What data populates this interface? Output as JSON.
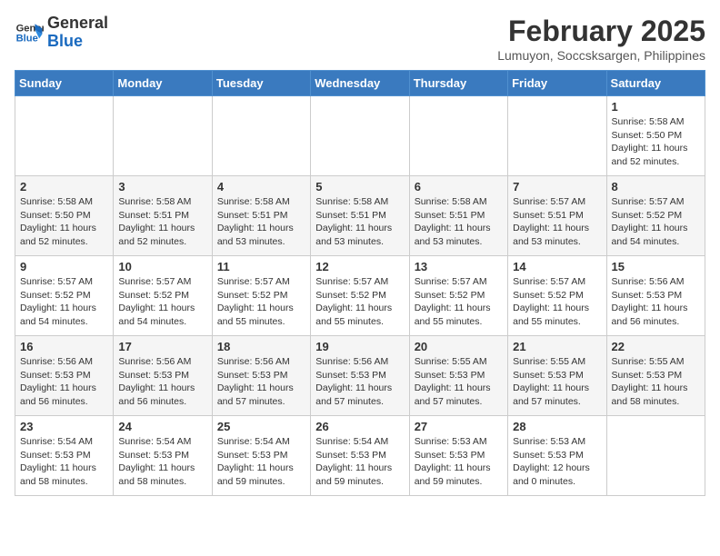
{
  "header": {
    "logo_line1": "General",
    "logo_line2": "Blue",
    "month_title": "February 2025",
    "subtitle": "Lumuyon, Soccsksargen, Philippines"
  },
  "weekdays": [
    "Sunday",
    "Monday",
    "Tuesday",
    "Wednesday",
    "Thursday",
    "Friday",
    "Saturday"
  ],
  "weeks": [
    [
      {
        "day": "",
        "info": ""
      },
      {
        "day": "",
        "info": ""
      },
      {
        "day": "",
        "info": ""
      },
      {
        "day": "",
        "info": ""
      },
      {
        "day": "",
        "info": ""
      },
      {
        "day": "",
        "info": ""
      },
      {
        "day": "1",
        "info": "Sunrise: 5:58 AM\nSunset: 5:50 PM\nDaylight: 11 hours\nand 52 minutes."
      }
    ],
    [
      {
        "day": "2",
        "info": "Sunrise: 5:58 AM\nSunset: 5:50 PM\nDaylight: 11 hours\nand 52 minutes."
      },
      {
        "day": "3",
        "info": "Sunrise: 5:58 AM\nSunset: 5:51 PM\nDaylight: 11 hours\nand 52 minutes."
      },
      {
        "day": "4",
        "info": "Sunrise: 5:58 AM\nSunset: 5:51 PM\nDaylight: 11 hours\nand 53 minutes."
      },
      {
        "day": "5",
        "info": "Sunrise: 5:58 AM\nSunset: 5:51 PM\nDaylight: 11 hours\nand 53 minutes."
      },
      {
        "day": "6",
        "info": "Sunrise: 5:58 AM\nSunset: 5:51 PM\nDaylight: 11 hours\nand 53 minutes."
      },
      {
        "day": "7",
        "info": "Sunrise: 5:57 AM\nSunset: 5:51 PM\nDaylight: 11 hours\nand 53 minutes."
      },
      {
        "day": "8",
        "info": "Sunrise: 5:57 AM\nSunset: 5:52 PM\nDaylight: 11 hours\nand 54 minutes."
      }
    ],
    [
      {
        "day": "9",
        "info": "Sunrise: 5:57 AM\nSunset: 5:52 PM\nDaylight: 11 hours\nand 54 minutes."
      },
      {
        "day": "10",
        "info": "Sunrise: 5:57 AM\nSunset: 5:52 PM\nDaylight: 11 hours\nand 54 minutes."
      },
      {
        "day": "11",
        "info": "Sunrise: 5:57 AM\nSunset: 5:52 PM\nDaylight: 11 hours\nand 55 minutes."
      },
      {
        "day": "12",
        "info": "Sunrise: 5:57 AM\nSunset: 5:52 PM\nDaylight: 11 hours\nand 55 minutes."
      },
      {
        "day": "13",
        "info": "Sunrise: 5:57 AM\nSunset: 5:52 PM\nDaylight: 11 hours\nand 55 minutes."
      },
      {
        "day": "14",
        "info": "Sunrise: 5:57 AM\nSunset: 5:52 PM\nDaylight: 11 hours\nand 55 minutes."
      },
      {
        "day": "15",
        "info": "Sunrise: 5:56 AM\nSunset: 5:53 PM\nDaylight: 11 hours\nand 56 minutes."
      }
    ],
    [
      {
        "day": "16",
        "info": "Sunrise: 5:56 AM\nSunset: 5:53 PM\nDaylight: 11 hours\nand 56 minutes."
      },
      {
        "day": "17",
        "info": "Sunrise: 5:56 AM\nSunset: 5:53 PM\nDaylight: 11 hours\nand 56 minutes."
      },
      {
        "day": "18",
        "info": "Sunrise: 5:56 AM\nSunset: 5:53 PM\nDaylight: 11 hours\nand 57 minutes."
      },
      {
        "day": "19",
        "info": "Sunrise: 5:56 AM\nSunset: 5:53 PM\nDaylight: 11 hours\nand 57 minutes."
      },
      {
        "day": "20",
        "info": "Sunrise: 5:55 AM\nSunset: 5:53 PM\nDaylight: 11 hours\nand 57 minutes."
      },
      {
        "day": "21",
        "info": "Sunrise: 5:55 AM\nSunset: 5:53 PM\nDaylight: 11 hours\nand 57 minutes."
      },
      {
        "day": "22",
        "info": "Sunrise: 5:55 AM\nSunset: 5:53 PM\nDaylight: 11 hours\nand 58 minutes."
      }
    ],
    [
      {
        "day": "23",
        "info": "Sunrise: 5:54 AM\nSunset: 5:53 PM\nDaylight: 11 hours\nand 58 minutes."
      },
      {
        "day": "24",
        "info": "Sunrise: 5:54 AM\nSunset: 5:53 PM\nDaylight: 11 hours\nand 58 minutes."
      },
      {
        "day": "25",
        "info": "Sunrise: 5:54 AM\nSunset: 5:53 PM\nDaylight: 11 hours\nand 59 minutes."
      },
      {
        "day": "26",
        "info": "Sunrise: 5:54 AM\nSunset: 5:53 PM\nDaylight: 11 hours\nand 59 minutes."
      },
      {
        "day": "27",
        "info": "Sunrise: 5:53 AM\nSunset: 5:53 PM\nDaylight: 11 hours\nand 59 minutes."
      },
      {
        "day": "28",
        "info": "Sunrise: 5:53 AM\nSunset: 5:53 PM\nDaylight: 12 hours\nand 0 minutes."
      },
      {
        "day": "",
        "info": ""
      }
    ]
  ]
}
